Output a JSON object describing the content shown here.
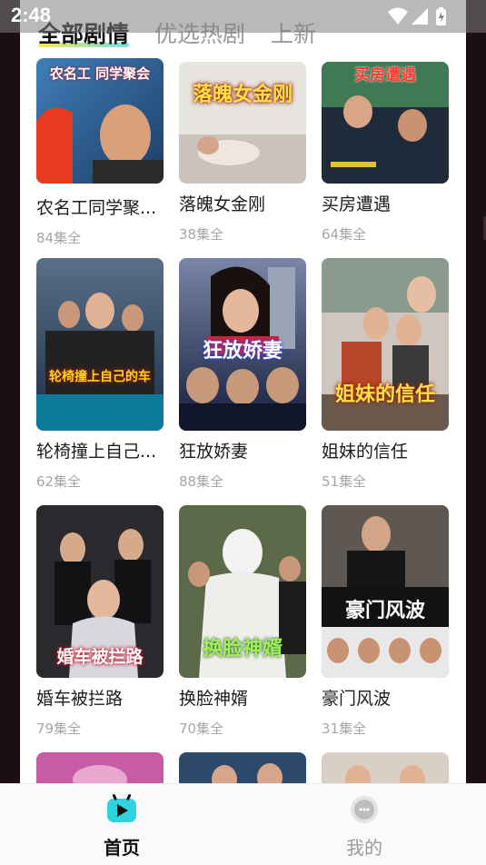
{
  "status": {
    "time": "2:48"
  },
  "tabs": [
    {
      "label": "全部剧情",
      "active": true
    },
    {
      "label": "优选热剧",
      "active": false
    },
    {
      "label": "上新",
      "active": false
    }
  ],
  "dramas": [
    {
      "title": "农名工同学聚...",
      "episodes": "84集全",
      "poster_text": "农名工 同学聚会"
    },
    {
      "title": "落魄女金刚",
      "episodes": "38集全",
      "poster_text": "落魄女金刚"
    },
    {
      "title": "买房遭遇",
      "episodes": "64集全",
      "poster_text": "买房遭遇"
    },
    {
      "title": "轮椅撞上自己...",
      "episodes": "62集全",
      "poster_text": "轮椅撞上自己的车"
    },
    {
      "title": "狂放娇妻",
      "episodes": "88集全",
      "poster_text": "狂放娇妻"
    },
    {
      "title": "姐妹的信任",
      "episodes": "51集全",
      "poster_text": "姐妹的信任"
    },
    {
      "title": "婚车被拦路",
      "episodes": "79集全",
      "poster_text": "婚车被拦路"
    },
    {
      "title": "换脸神婿",
      "episodes": "70集全",
      "poster_text": "换脸神婿"
    },
    {
      "title": "豪门风波",
      "episodes": "31集全",
      "poster_text": "豪门风波"
    }
  ],
  "bottom_nav": [
    {
      "label": "首页",
      "icon": "tv-icon",
      "active": true,
      "color": "#2fd3e0"
    },
    {
      "label": "我的",
      "icon": "user-chat-icon",
      "active": false,
      "color": "#bdbdbd"
    }
  ]
}
